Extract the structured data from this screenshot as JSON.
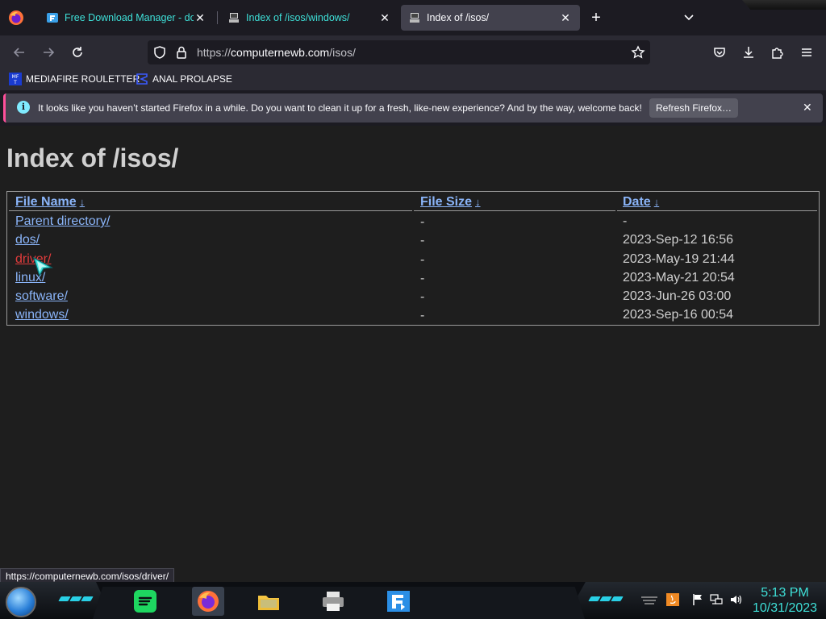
{
  "browser": {
    "tabs": [
      {
        "title": "Free Download Manager - dow",
        "active": false
      },
      {
        "title": "Index of /isos/windows/",
        "active": false
      },
      {
        "title": "Index of /isos/",
        "active": true
      }
    ],
    "url": {
      "scheme": "https://",
      "host": "computernewb.com",
      "path": "/isos/"
    },
    "bookmarks": [
      {
        "label": "MEDIAFIRE ROULETTER",
        "icon": "mft-icon"
      },
      {
        "label": "ANAL PROLAPSE",
        "icon": "sigma-icon"
      }
    ],
    "notification": {
      "message": "It looks like you haven’t started Firefox in a while. Do you want to clean it up for a fresh, like-new experience? And by the way, welcome back!",
      "button": "Refresh Firefox…"
    },
    "status_link": "https://computernewb.com/isos/driver/"
  },
  "page": {
    "heading": "Index of /isos/",
    "columns": [
      {
        "label": "File Name",
        "arrow": "↓"
      },
      {
        "label": "File Size",
        "arrow": "↓"
      },
      {
        "label": "Date",
        "arrow": "↓"
      }
    ],
    "rows": [
      {
        "name": "Parent directory/",
        "size": "-",
        "date": "-"
      },
      {
        "name": "dos/",
        "size": "-",
        "date": "2023-Sep-12 16:56"
      },
      {
        "name": "driver/",
        "size": "-",
        "date": "2023-May-19 21:44"
      },
      {
        "name": "linux/",
        "size": "-",
        "date": "2023-May-21 20:54"
      },
      {
        "name": "software/",
        "size": "-",
        "date": "2023-Jun-26 03:00"
      },
      {
        "name": "windows/",
        "size": "-",
        "date": "2023-Sep-16 00:54"
      }
    ]
  },
  "taskbar": {
    "apps": [
      "spotify-icon",
      "firefox-icon",
      "file-explorer-icon",
      "printer-icon",
      "free-download-manager-icon"
    ],
    "clock": {
      "time": "5:13 PM",
      "date": "10/31/2023"
    }
  },
  "colors": {
    "accent_teal": "#3ee0d8",
    "link": "#8ab4f8",
    "link_hover": "#e23c3c",
    "notice_stripe": "#ff4f9a"
  }
}
